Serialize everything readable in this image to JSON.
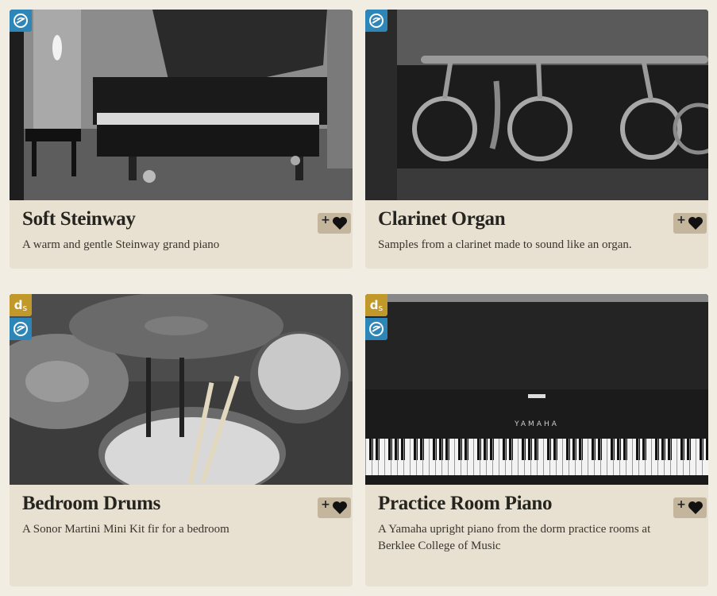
{
  "cards": [
    {
      "title": "Soft Steinway",
      "description": "A warm and gentle Steinway grand piano",
      "badges": [
        "blue-disc-icon"
      ],
      "action_plus": "+"
    },
    {
      "title": "Clarinet Organ",
      "description": "Samples from a clarinet made to sound like an organ.",
      "badges": [
        "blue-disc-icon"
      ],
      "action_plus": "+"
    },
    {
      "title": "Bedroom Drums",
      "description": "A Sonor Martini Mini Kit fir for a bedroom",
      "badges": [
        "ds-badge",
        "blue-disc-icon"
      ],
      "action_plus": "+"
    },
    {
      "title": "Practice Room Piano",
      "description": "A Yamaha upright piano from the dorm practice rooms at Berklee College of Music",
      "badges": [
        "ds-badge",
        "blue-disc-icon"
      ],
      "action_plus": "+",
      "photo_brand_text": "YAMAHA"
    }
  ],
  "ds_badge": {
    "d": "d",
    "s": "s"
  },
  "colors": {
    "background": "#f1ede3",
    "card": "#e8e1d1",
    "action": "#c3b69c",
    "blue_badge": "#2e86b8",
    "gold_badge": "#c0992a"
  }
}
